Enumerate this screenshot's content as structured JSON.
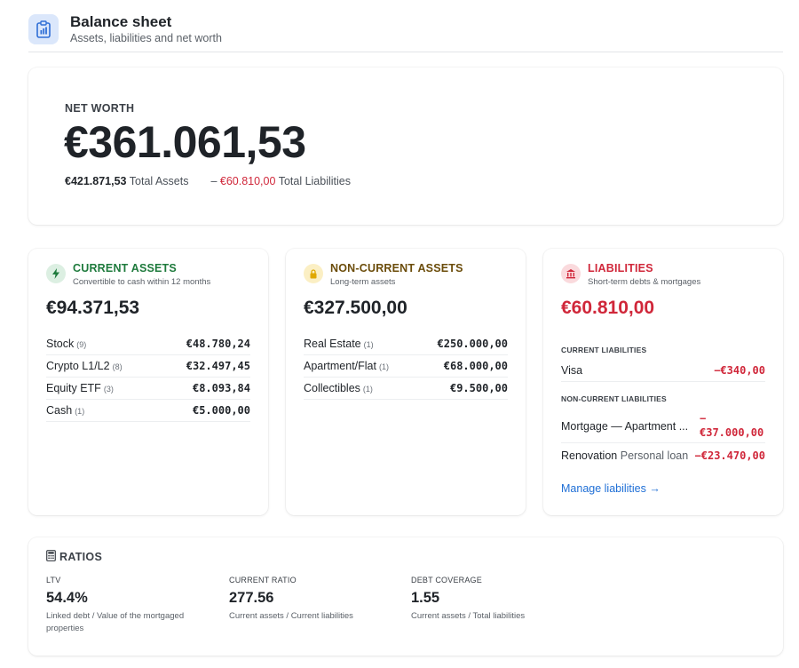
{
  "header": {
    "title": "Balance sheet",
    "subtitle": "Assets, liabilities and net worth",
    "icon": "clipboard-chart-icon"
  },
  "net_worth": {
    "label": "NET WORTH",
    "value": "€361.061,53",
    "total_assets_value": "€421.871,53",
    "total_assets_label": "Total Assets",
    "separator": "–",
    "total_liabilities_value": "€60.810,00",
    "total_liabilities_label": "Total Liabilities"
  },
  "current_assets": {
    "icon": "lightning-icon",
    "title": "CURRENT ASSETS",
    "subtitle": "Convertible to cash within 12 months",
    "total": "€94.371,53",
    "color": "#1e7a3c",
    "items": [
      {
        "name": "Stock",
        "count": "(9)",
        "amount": "€48.780,24"
      },
      {
        "name": "Crypto L1/L2",
        "count": "(8)",
        "amount": "€32.497,45"
      },
      {
        "name": "Equity ETF",
        "count": "(3)",
        "amount": "€8.093,84"
      },
      {
        "name": "Cash",
        "count": "(1)",
        "amount": "€5.000,00"
      }
    ]
  },
  "non_current_assets": {
    "icon": "lock-icon",
    "title": "NON-CURRENT ASSETS",
    "subtitle": "Long-term assets",
    "total": "€327.500,00",
    "color": "#6b4c0a",
    "items": [
      {
        "name": "Real Estate",
        "count": "(1)",
        "amount": "€250.000,00"
      },
      {
        "name": "Apartment/Flat",
        "count": "(1)",
        "amount": "€68.000,00"
      },
      {
        "name": "Collectibles",
        "count": "(1)",
        "amount": "€9.500,00"
      }
    ]
  },
  "liabilities": {
    "icon": "bank-icon",
    "title": "LIABILITIES",
    "subtitle": "Short-term debts & mortgages",
    "total": "€60.810,00",
    "color": "#d0273a",
    "current_label": "CURRENT LIABILITIES",
    "current_items": [
      {
        "name": "Visa",
        "amount": "−€340,00"
      }
    ],
    "non_current_label": "NON-CURRENT LIABILITIES",
    "non_current_items": [
      {
        "name": "Mortgage — Apartment ...",
        "amount_sign": "−",
        "amount": "€37.000,00"
      },
      {
        "name": "Renovation",
        "note": "Personal loan",
        "amount": "−€23.470,00"
      }
    ],
    "manage_link": "Manage liabilities →"
  },
  "ratios": {
    "icon": "calculator-icon",
    "title": "RATIOS",
    "items": [
      {
        "label": "LTV",
        "value": "54.4%",
        "note": "Linked debt / Value of the mortgaged properties"
      },
      {
        "label": "CURRENT RATIO",
        "value": "277.56",
        "note": "Current assets / Current liabilities"
      },
      {
        "label": "DEBT COVERAGE",
        "value": "1.55",
        "note": "Current assets / Total liabilities"
      }
    ]
  }
}
